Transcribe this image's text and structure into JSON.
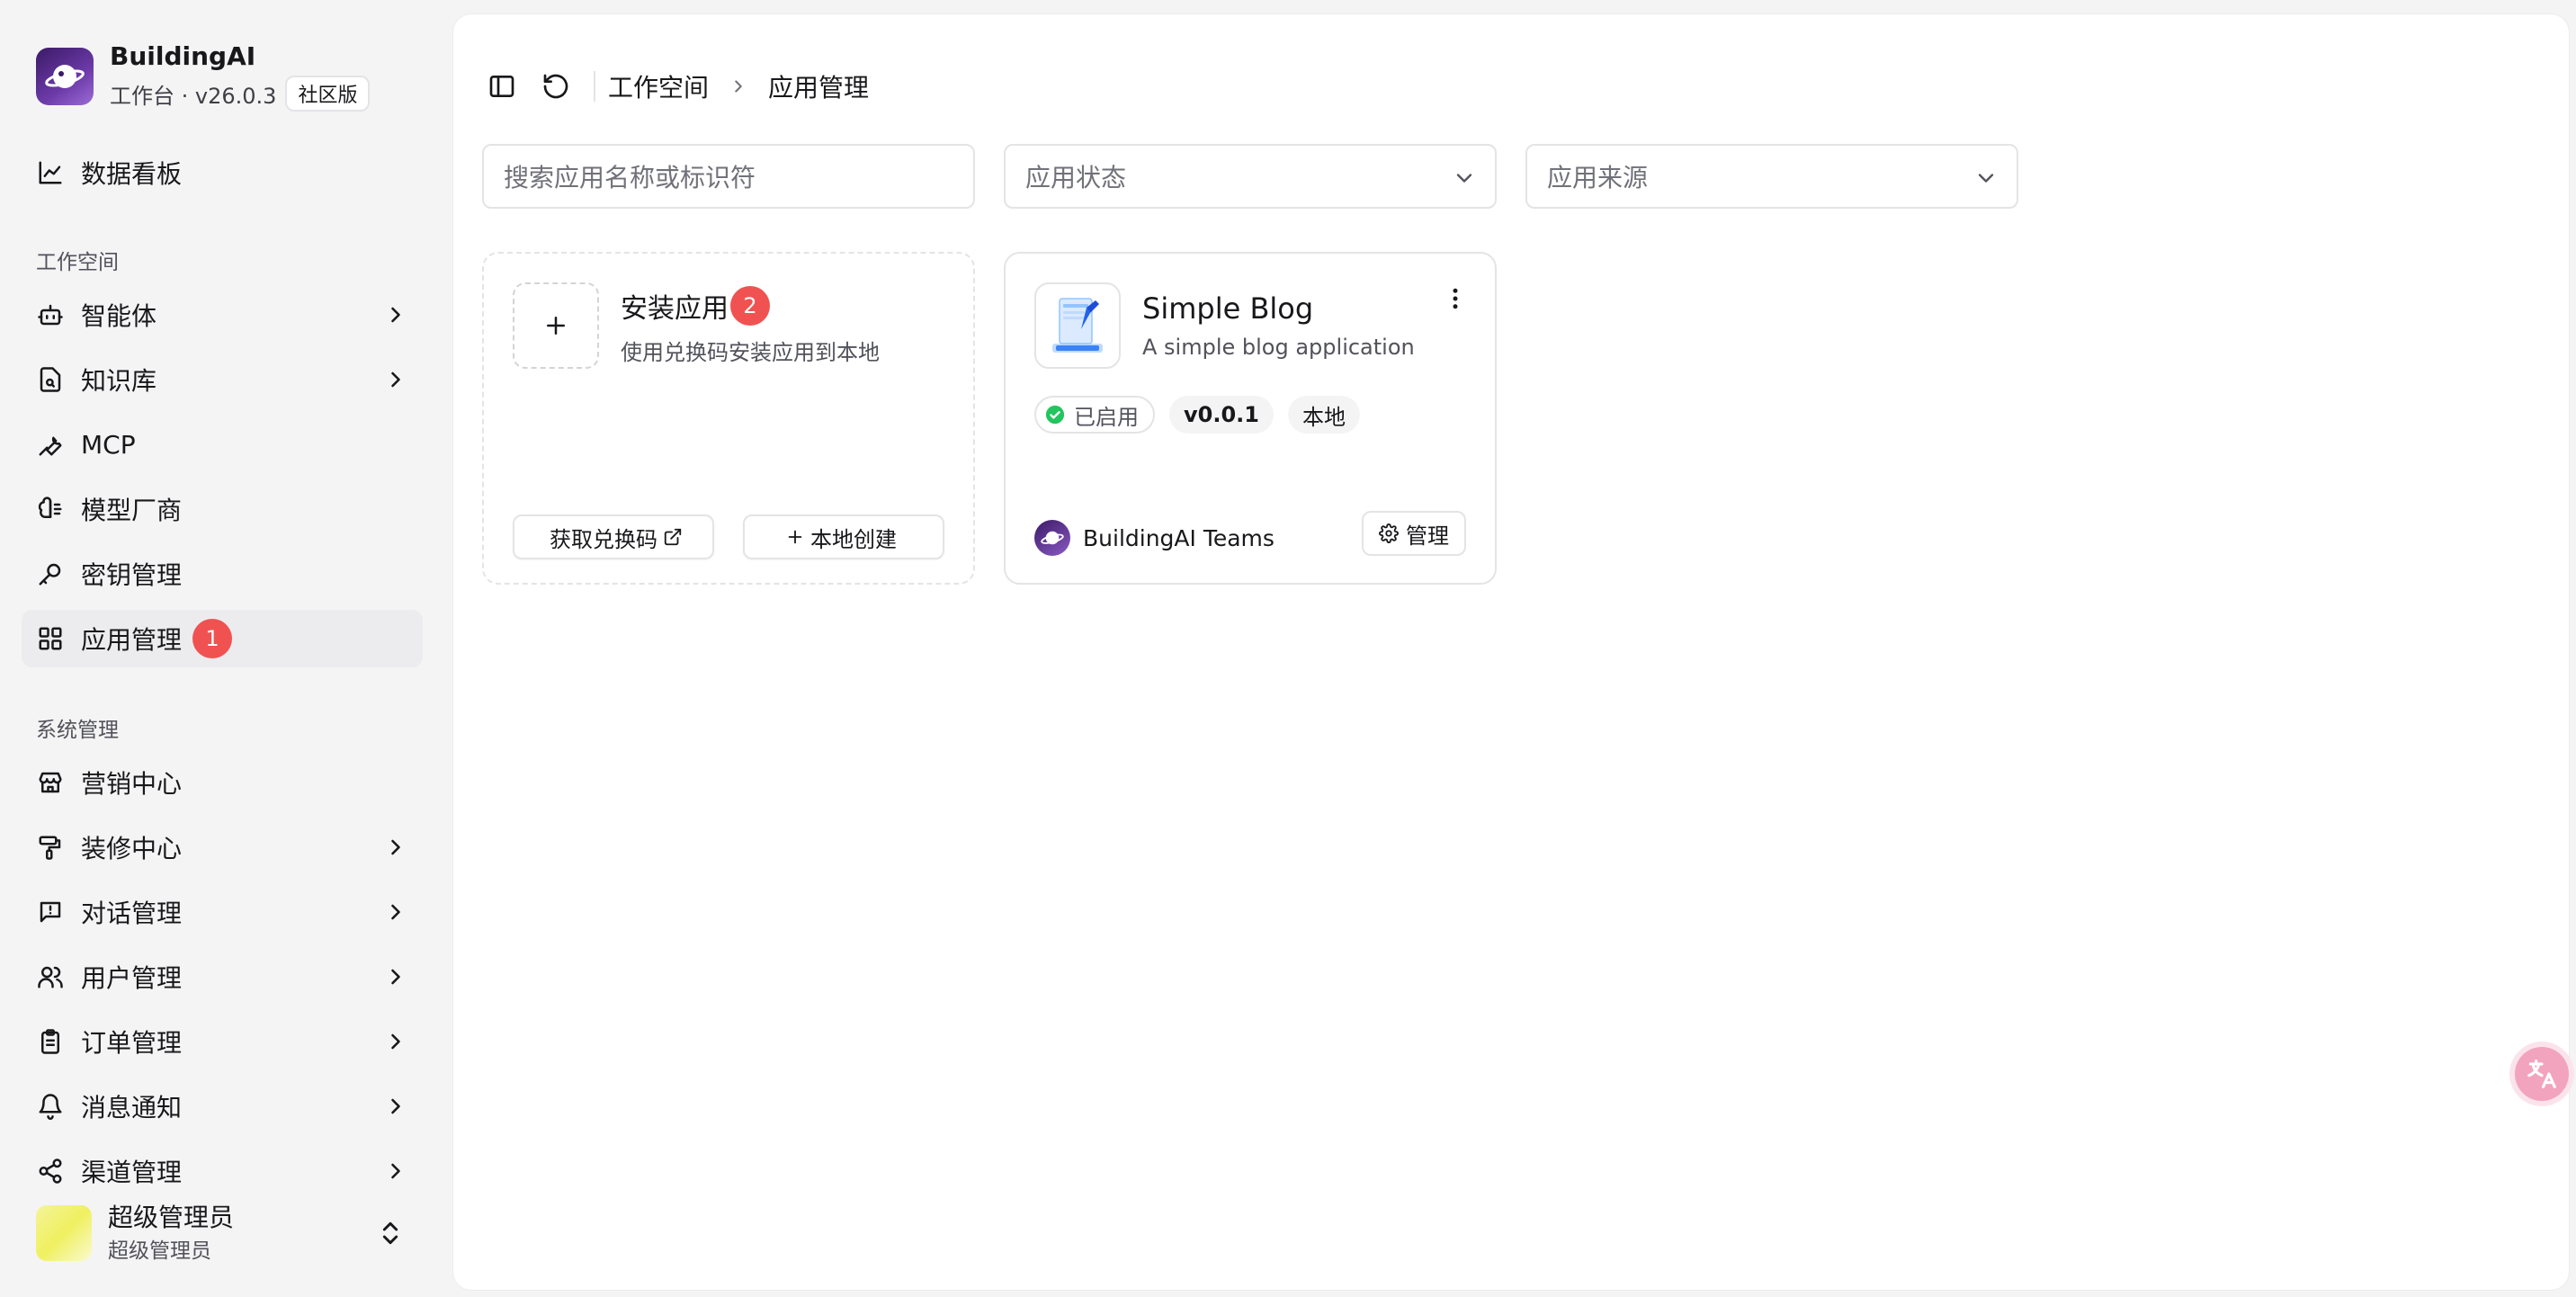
{
  "brand": {
    "name": "BuildingAI",
    "subtitle": "工作台 · v26.0.3",
    "edition": "社区版"
  },
  "sidebar": {
    "dashboard": "数据看板",
    "workspace_section": "工作空间",
    "workspace_items": [
      {
        "label": "智能体",
        "icon": "bot-icon",
        "has_children": true
      },
      {
        "label": "知识库",
        "icon": "file-search-icon",
        "has_children": true
      },
      {
        "label": "MCP",
        "icon": "wrench-icon",
        "has_children": false
      },
      {
        "label": "模型厂商",
        "icon": "brain-icon",
        "has_children": false
      },
      {
        "label": "密钥管理",
        "icon": "key-icon",
        "has_children": false
      },
      {
        "label": "应用管理",
        "icon": "grid-icon",
        "has_children": false,
        "active": true,
        "badge": "1"
      }
    ],
    "system_section": "系统管理",
    "system_items": [
      {
        "label": "营销中心",
        "icon": "store-icon",
        "has_children": false
      },
      {
        "label": "装修中心",
        "icon": "paint-roller-icon",
        "has_children": true
      },
      {
        "label": "对话管理",
        "icon": "message-icon",
        "has_children": true
      },
      {
        "label": "用户管理",
        "icon": "users-icon",
        "has_children": true
      },
      {
        "label": "订单管理",
        "icon": "clipboard-icon",
        "has_children": true
      },
      {
        "label": "消息通知",
        "icon": "bell-icon",
        "has_children": true
      },
      {
        "label": "渠道管理",
        "icon": "share-icon",
        "has_children": true
      }
    ]
  },
  "user": {
    "name": "超级管理员",
    "role": "超级管理员"
  },
  "breadcrumb": {
    "parent": "工作空间",
    "current": "应用管理"
  },
  "filters": {
    "search_placeholder": "搜索应用名称或标识符",
    "status_placeholder": "应用状态",
    "source_placeholder": "应用来源"
  },
  "install_card": {
    "title": "安装应用",
    "badge": "2",
    "description": "使用兑换码安装应用到本地",
    "redeem_button": "获取兑换码",
    "local_create_button": "本地创建"
  },
  "apps": [
    {
      "name": "Simple Blog",
      "description": "A simple blog application",
      "status": "已启用",
      "version": "v0.0.1",
      "source": "本地",
      "author": "BuildingAI Teams",
      "manage_label": "管理"
    }
  ],
  "colors": {
    "badge": "#f05252",
    "status_green": "#22c55e",
    "active_bg": "#ececee"
  }
}
